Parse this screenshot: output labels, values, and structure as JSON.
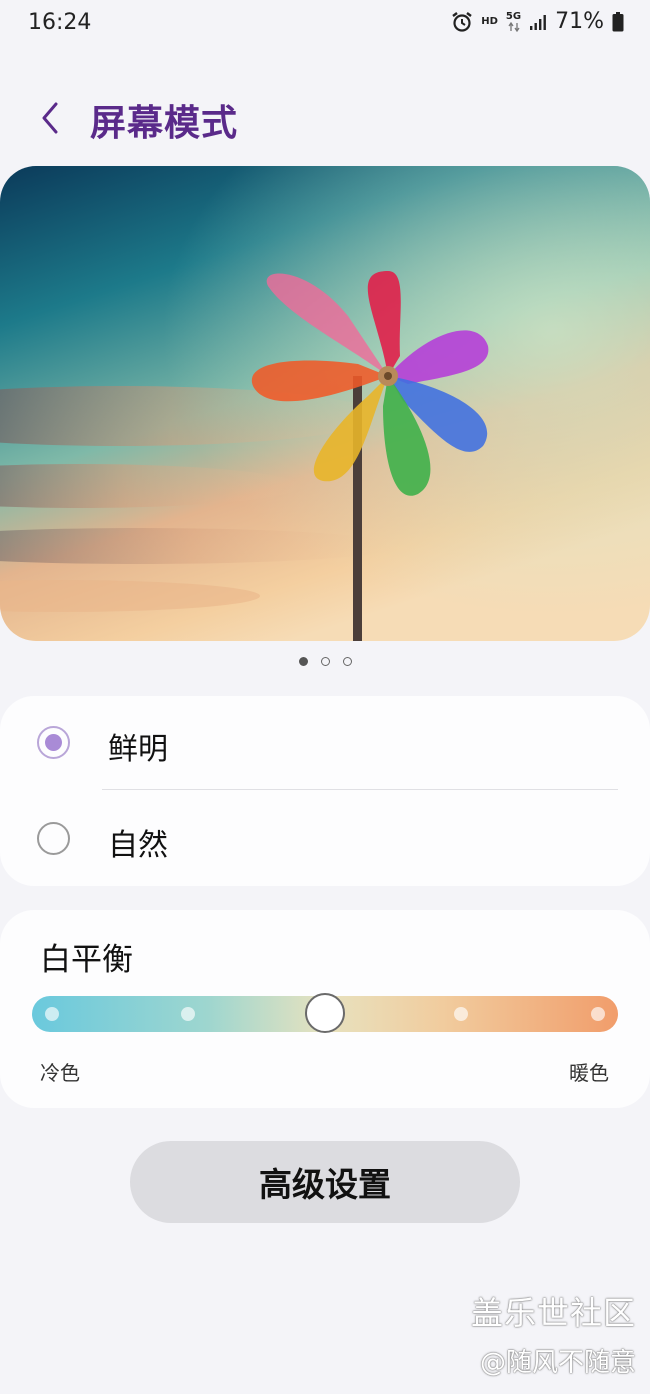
{
  "status_bar": {
    "time": "16:24",
    "hd_label": "HD",
    "network_label": "5G",
    "battery_percent": "71%",
    "icons": [
      "alarm-icon",
      "hd-voice-icon",
      "5g-data-icon",
      "signal-icon",
      "battery-icon"
    ]
  },
  "header": {
    "back_icon": "chevron-left-icon",
    "title": "屏幕模式"
  },
  "preview": {
    "image": "pinwheel-against-sunset-sky",
    "page_count": 3,
    "active_page": 1
  },
  "modes": {
    "options": [
      {
        "label": "鲜明",
        "selected": true
      },
      {
        "label": "自然",
        "selected": false
      }
    ]
  },
  "white_balance": {
    "title": "白平衡",
    "cool_label": "冷色",
    "warm_label": "暖色",
    "steps": 5,
    "value_step": 3
  },
  "advanced_button": {
    "label": "高级设置"
  },
  "watermark": {
    "brand": "盖乐世社区",
    "user": "@随风不随意"
  },
  "colors": {
    "title_purple": "#5a2a8a",
    "radio_accent": "#a98bd6",
    "page_background": "#f4f4f8",
    "card_background": "#fdfdfe",
    "button_background": "#dcdce0"
  }
}
